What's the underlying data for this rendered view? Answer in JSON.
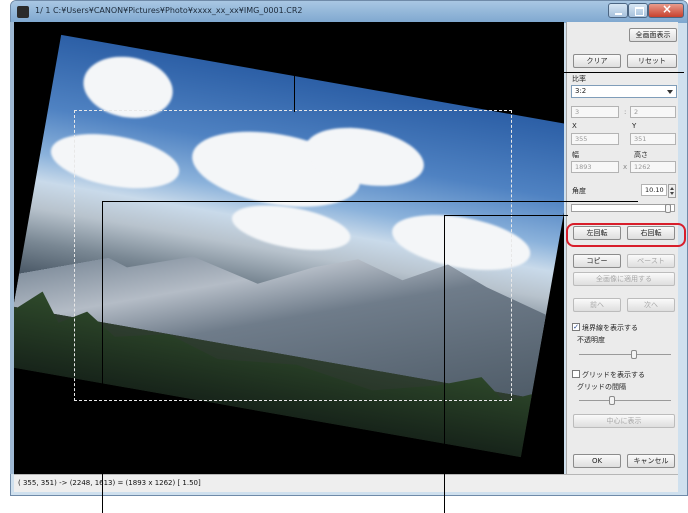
{
  "window": {
    "title": "1/  1  C:¥Users¥CANON¥Pictures¥Photo¥xxxx_xx_xx¥IMG_0001.CR2"
  },
  "panel": {
    "fullscreen_label": "全画面表示",
    "clear_label": "クリア",
    "reset_label": "リセット",
    "ratio_label": "比率",
    "ratio_value": "3:2",
    "ratio_w": "3",
    "ratio_sep": ":",
    "ratio_h": "2",
    "x_label": "X",
    "y_label": "Y",
    "x_value": "355",
    "y_value": "351",
    "width_label": "幅",
    "height_label": "高さ",
    "width_value": "1893",
    "size_sep": "x",
    "height_value": "1262",
    "angle_label": "角度",
    "angle_value": "10.10",
    "angle_fraction": 0.95,
    "rotate_left_label": "左回転",
    "rotate_right_label": "右回転",
    "copy_label": "コピー",
    "paste_label": "ペースト",
    "apply_all_label": "全画像に適用する",
    "prev_label": "前へ",
    "next_label": "次へ",
    "show_border_label": "境界線を表示する",
    "show_border_checked": true,
    "opacity_label": "不透明度",
    "opacity_fraction": 0.6,
    "show_grid_label": "グリッドを表示する",
    "show_grid_checked": false,
    "grid_spacing_label": "グリッドの間隔",
    "grid_spacing_fraction": 0.35,
    "center_label": "中心に表示",
    "ok_label": "OK",
    "cancel_label": "キャンセル"
  },
  "status": {
    "text": "( 355,  351) -> (2248, 1613) = (1893 x 1262) [ 1.50]"
  },
  "colors": {
    "highlight": "#d81e2b",
    "panel_bg": "#ebebeb",
    "title_bar": "#7ea7cf"
  }
}
